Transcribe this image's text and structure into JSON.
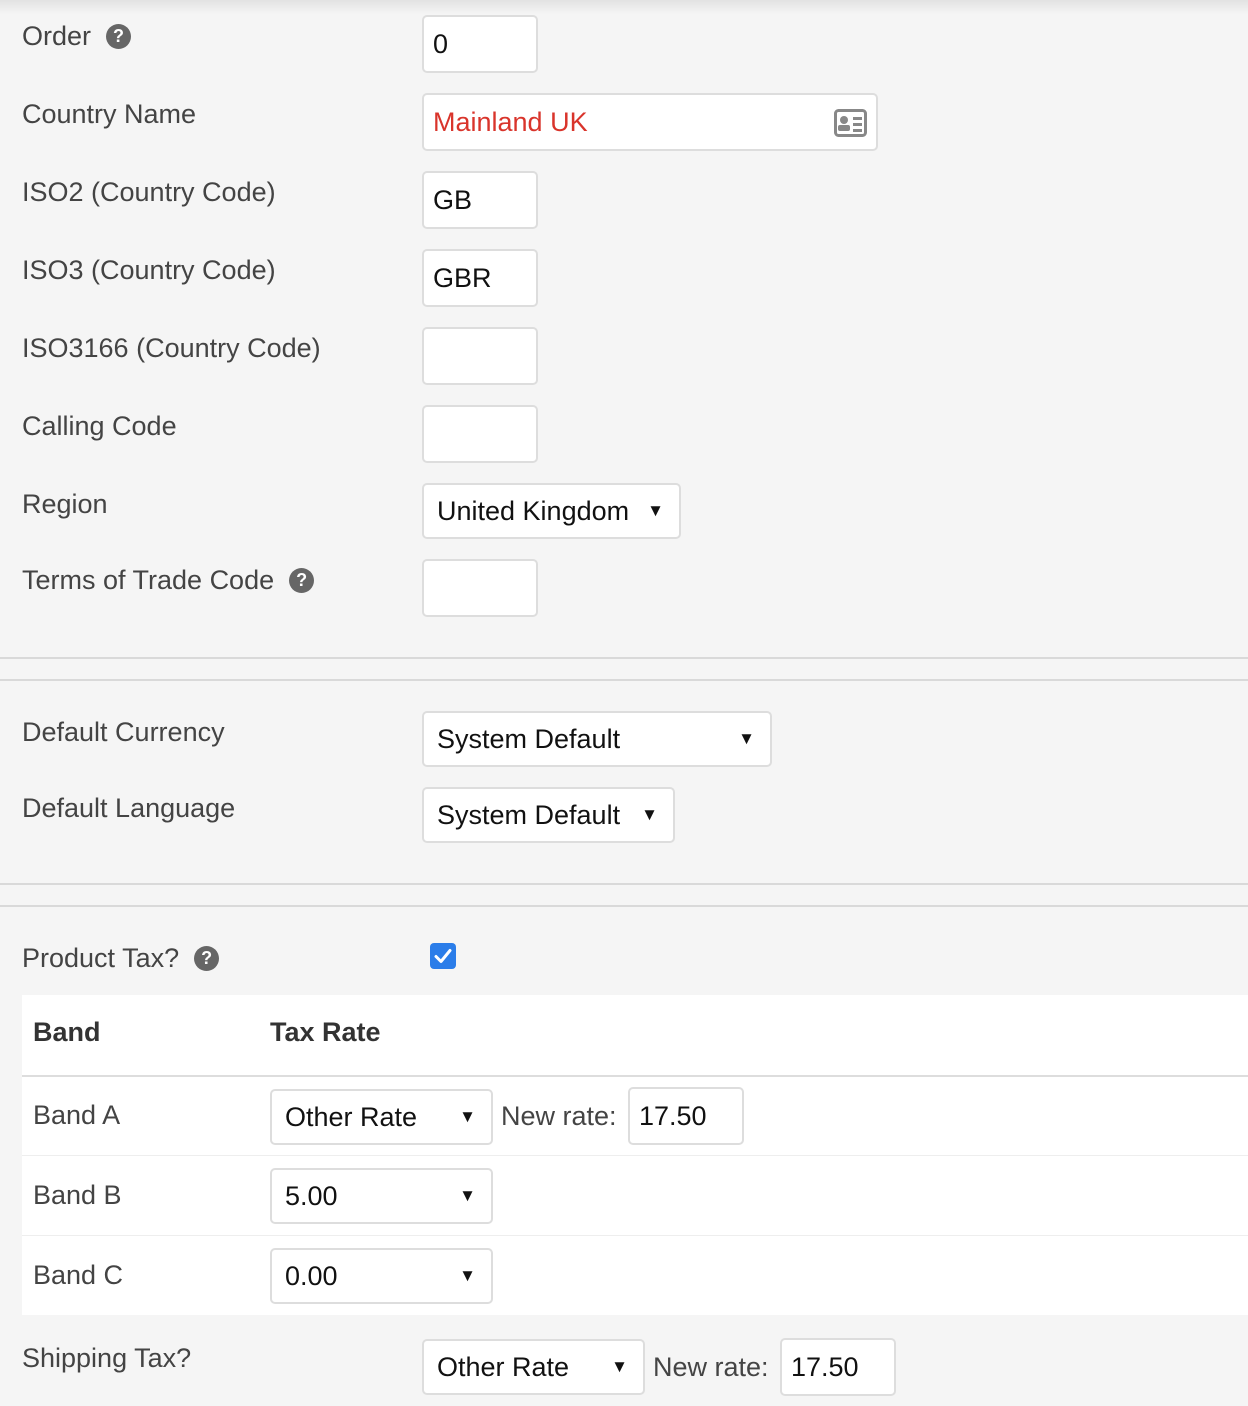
{
  "fields": {
    "order": {
      "label": "Order",
      "value": "0"
    },
    "country_name": {
      "label": "Country Name",
      "value": "Mainland UK"
    },
    "iso2": {
      "label": "ISO2 (Country Code)",
      "value": "GB"
    },
    "iso3": {
      "label": "ISO3 (Country Code)",
      "value": "GBR"
    },
    "iso3166": {
      "label": "ISO3166 (Country Code)",
      "value": ""
    },
    "calling_code": {
      "label": "Calling Code",
      "value": ""
    },
    "region": {
      "label": "Region",
      "value": "United Kingdom"
    },
    "terms_of_trade": {
      "label": "Terms of Trade Code",
      "value": ""
    }
  },
  "defaults": {
    "currency": {
      "label": "Default Currency",
      "value": "System Default"
    },
    "language": {
      "label": "Default Language",
      "value": "System Default"
    }
  },
  "tax": {
    "product_tax_label": "Product Tax?",
    "product_tax_checked": true,
    "table": {
      "headers": [
        "Band",
        "Tax Rate"
      ],
      "rows": [
        {
          "band": "Band A",
          "rate": "Other Rate",
          "new_rate_label": "New rate:",
          "new_rate": "17.50"
        },
        {
          "band": "Band B",
          "rate": "5.00"
        },
        {
          "band": "Band C",
          "rate": "0.00"
        }
      ]
    },
    "shipping": {
      "label": "Shipping Tax?",
      "rate": "Other Rate",
      "new_rate_label": "New rate:",
      "new_rate": "17.50"
    }
  },
  "icons": {
    "help": "question-circle-icon",
    "contact_card": "contact-card-icon",
    "caret": "caret-down-icon",
    "check": "checkmark-icon"
  },
  "colors": {
    "country_name_text": "#d9342b",
    "checkbox": "#2b7de9"
  }
}
